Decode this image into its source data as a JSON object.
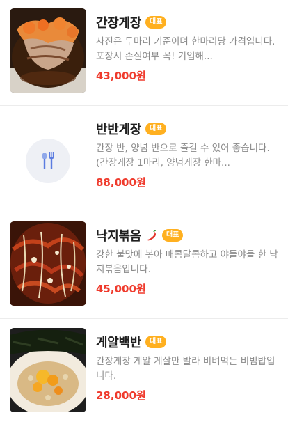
{
  "menu": {
    "items": [
      {
        "name": "간장게장",
        "badge": "대표",
        "description": "사진은 두마리 기준이며 한마리당 가격입니다. 포장시 손질여부 꼭! 기입해...",
        "price": "43,000원",
        "image": "soy-crab-photo"
      },
      {
        "name": "반반게장",
        "badge": "대표",
        "description": "간장 반, 양념 반으로 즐길 수 있어 좋습니다.(간장게장 1마리, 양념게장 한마...",
        "price": "88,000원",
        "image": "fork-spoon-icon"
      },
      {
        "name": "낙지볶음",
        "badge": "대표",
        "description": "강한 불맛에 볶아 매콤달콤하고 야들야들 한 낙지볶음입니다.",
        "price": "45,000원",
        "image": "octopus-stirfry-photo",
        "spicy_icon": "chili-pepper-icon"
      },
      {
        "name": "게알백반",
        "badge": "대표",
        "description": "간장게장 게알 게살만 발라 비벼먹는 비빔밥입니다.",
        "price": "28,000원",
        "image": "crab-roe-rice-photo"
      }
    ]
  },
  "colors": {
    "badge": "#ffb020",
    "price": "#ef3b2d",
    "description": "#8a8a8a",
    "placeholder_bg": "#eef0f5"
  }
}
